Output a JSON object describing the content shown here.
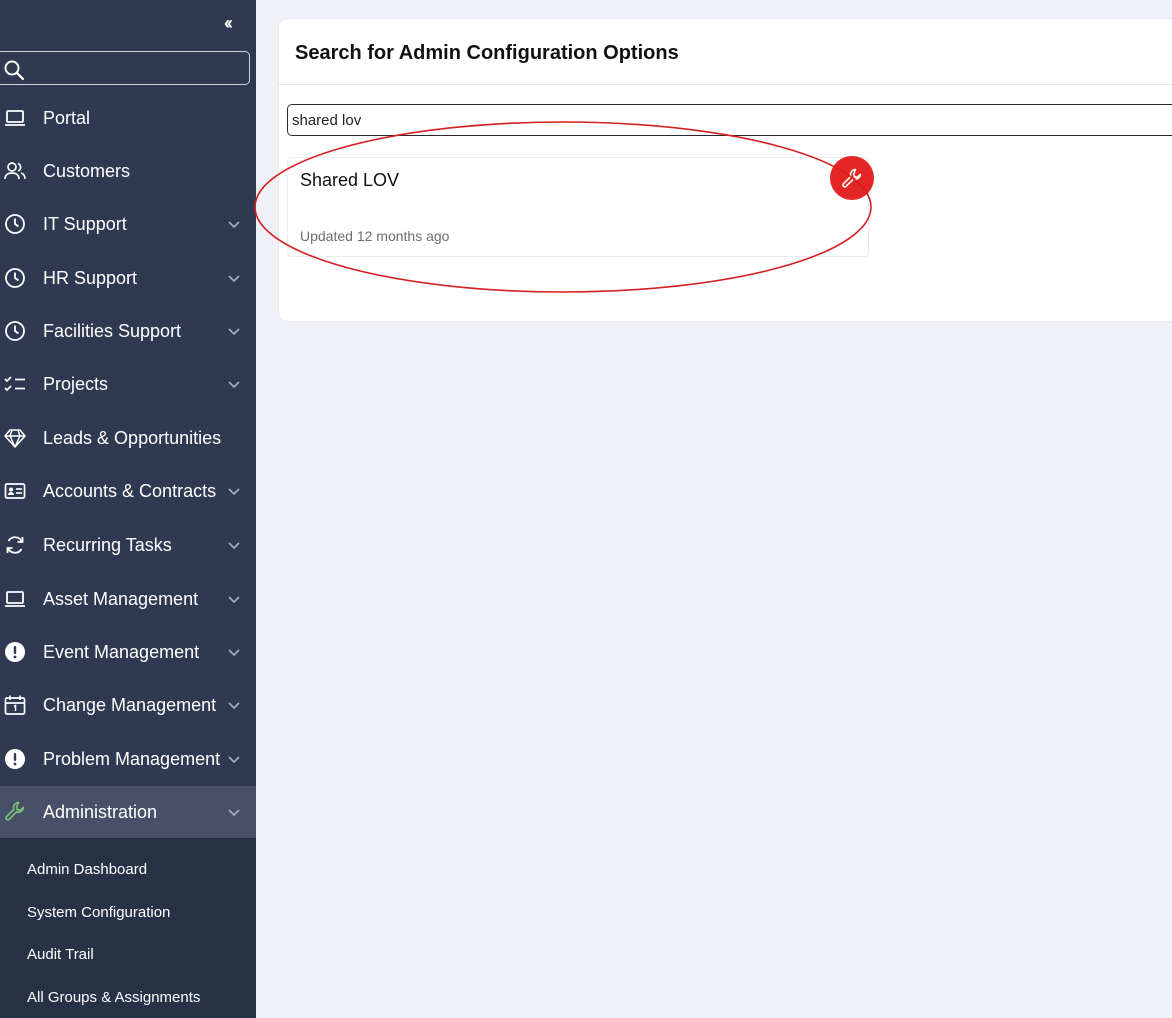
{
  "sidebar": {
    "collapse_label": "‹‹",
    "search": {
      "value": "",
      "placeholder": ""
    },
    "items": [
      {
        "label": "Portal",
        "icon": "laptop-icon",
        "has_chevron": false
      },
      {
        "label": "Customers",
        "icon": "users-icon",
        "has_chevron": false
      },
      {
        "label": "IT Support",
        "icon": "clock-icon",
        "has_chevron": true
      },
      {
        "label": "HR Support",
        "icon": "clock-icon",
        "has_chevron": true
      },
      {
        "label": "Facilities Support",
        "icon": "clock-icon",
        "has_chevron": true
      },
      {
        "label": "Projects",
        "icon": "checklist-icon",
        "has_chevron": true
      },
      {
        "label": "Leads & Opportunities",
        "icon": "diamond-icon",
        "has_chevron": false
      },
      {
        "label": "Accounts & Contracts",
        "icon": "id-card-icon",
        "has_chevron": true
      },
      {
        "label": "Recurring Tasks",
        "icon": "refresh-icon",
        "has_chevron": true
      },
      {
        "label": "Asset Management",
        "icon": "laptop-icon",
        "has_chevron": true
      },
      {
        "label": "Event Management",
        "icon": "alert-circle-icon",
        "has_chevron": true
      },
      {
        "label": "Change Management",
        "icon": "calendar-icon",
        "has_chevron": true
      },
      {
        "label": "Problem Management",
        "icon": "alert-circle-icon",
        "has_chevron": true
      },
      {
        "label": "Administration",
        "icon": "wrench-icon",
        "has_chevron": true,
        "active": true
      }
    ],
    "submenu": [
      "Admin Dashboard",
      "System Configuration",
      "Audit Trail",
      "All Groups & Assignments"
    ]
  },
  "main": {
    "title": "Search for Admin Configuration Options",
    "search": {
      "value": "shared lov",
      "placeholder": ""
    },
    "results": [
      {
        "title": "Shared LOV",
        "updated": "Updated 12 months ago",
        "icon": "wrench-icon"
      }
    ]
  },
  "colors": {
    "sidebar_bg": "#2f3a52",
    "sidebar_active": "#475068",
    "submenu_bg": "#283247",
    "page_bg": "#f0f1f6",
    "badge_red": "#e52626",
    "annotation_red": "#d42020",
    "admin_icon_green": "#7cc47a"
  }
}
